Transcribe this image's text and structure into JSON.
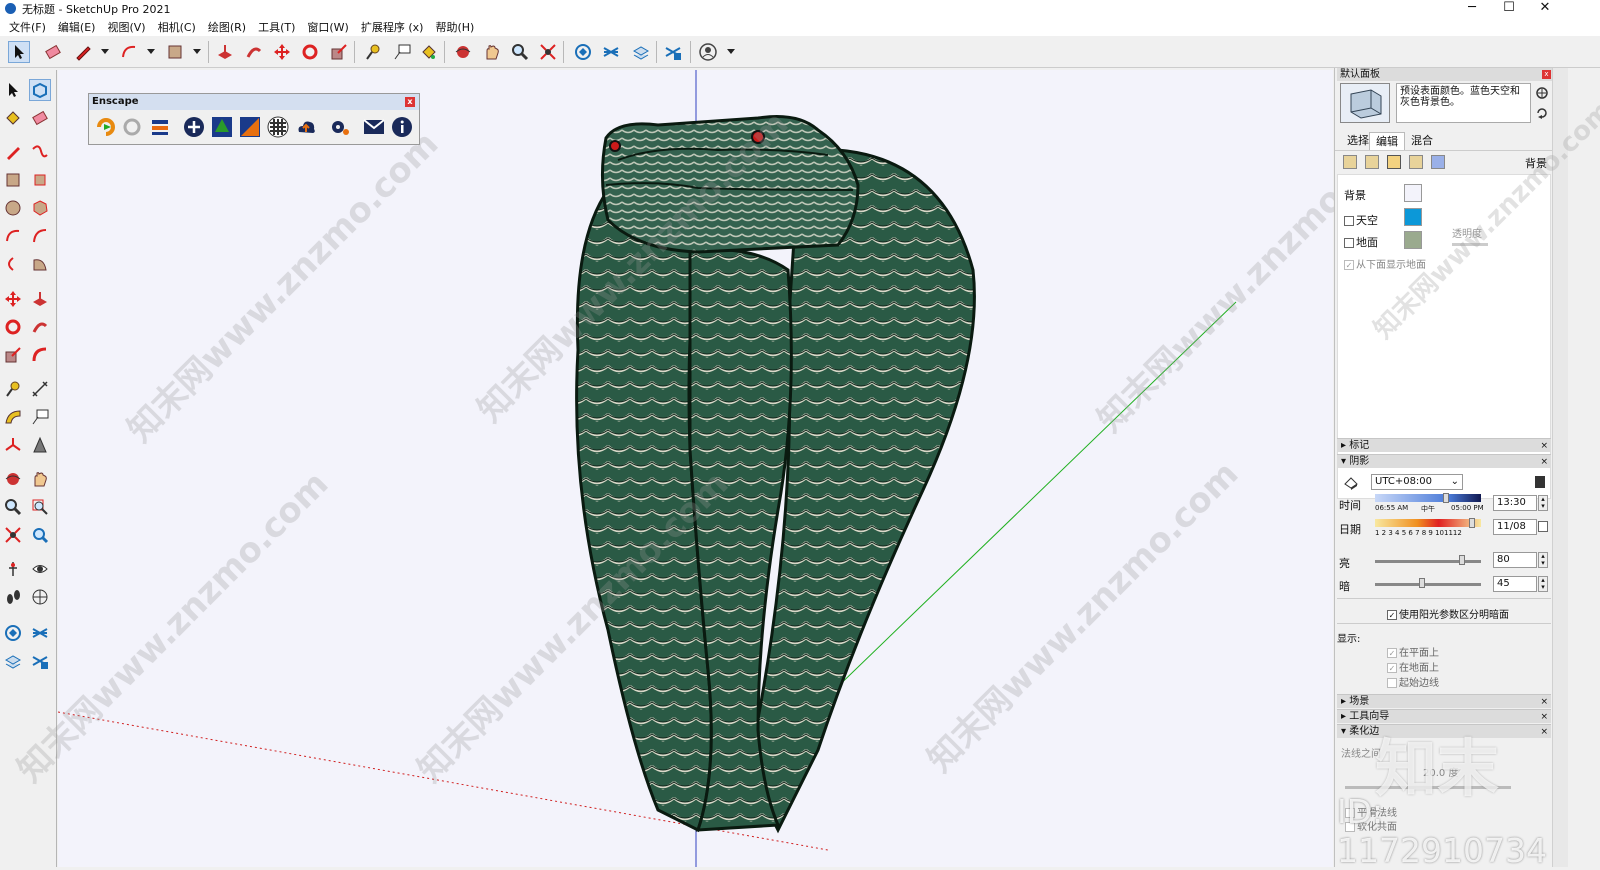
{
  "window": {
    "title": "无标题 - SketchUp Pro 2021",
    "minimize": "─",
    "maximize": "☐",
    "close": "✕"
  },
  "menu": [
    "文件(F)",
    "编辑(E)",
    "视图(V)",
    "相机(C)",
    "绘图(R)",
    "工具(T)",
    "窗口(W)",
    "扩展程序 (x)",
    "帮助(H)"
  ],
  "enscape": {
    "title": "Enscape",
    "close": "x"
  },
  "tray": {
    "title": "默认面板",
    "style_description": "预设表面颜色。蓝色天空和灰色背景色。",
    "tabs": [
      "选择",
      "编辑",
      "混合"
    ],
    "active_tab": "编辑",
    "edit_section_label": "背景",
    "background": {
      "label": "背景",
      "color": "#f3f3fb"
    },
    "sky": {
      "label": "天空",
      "checked": false,
      "color": "#0c98d8"
    },
    "ground": {
      "label": "地面",
      "checked": false,
      "color": "#9aaa8e"
    },
    "transparency_label": "透明度",
    "show_ground_below": "从下面显示地面"
  },
  "sections": {
    "tags": "标记",
    "shadows": "阴影",
    "scenes": "场景",
    "instructor": "工具向导",
    "soften": "柔化边"
  },
  "shadows": {
    "timezone": "UTC+08:00",
    "time_label": "时间",
    "time_scale": [
      "06:55 AM",
      "中午",
      "05:00 PM"
    ],
    "time_value": "13:30",
    "date_label": "日期",
    "date_scale": "1 2 3 4 5 6 7 8 9 101112",
    "date_value": "11/08",
    "light_label": "亮",
    "light_value": "80",
    "dark_label": "暗",
    "dark_value": "45",
    "use_sun_label": "使用阳光参数区分明暗面",
    "use_sun_checked": true,
    "display_label": "显示:",
    "on_faces": "在平面上",
    "on_ground": "在地面上",
    "from_edges": "起始边线"
  },
  "soften": {
    "normals_label": "法线之间",
    "angle": "20.0 度",
    "smooth_normals": "平滑法线",
    "soften_coplanar": "软化共面"
  },
  "watermark": {
    "text": "知末网www.znzmo.com",
    "logo": "知末",
    "id": "ID: 1172910734"
  },
  "colors": {
    "snake_body": "#2a5a45",
    "scale_highlight": "#d8d8c8",
    "eye": "#cc1a1a",
    "axis_green": "#20b020",
    "axis_red": "#d02020",
    "axis_blue": "#3040c0"
  }
}
